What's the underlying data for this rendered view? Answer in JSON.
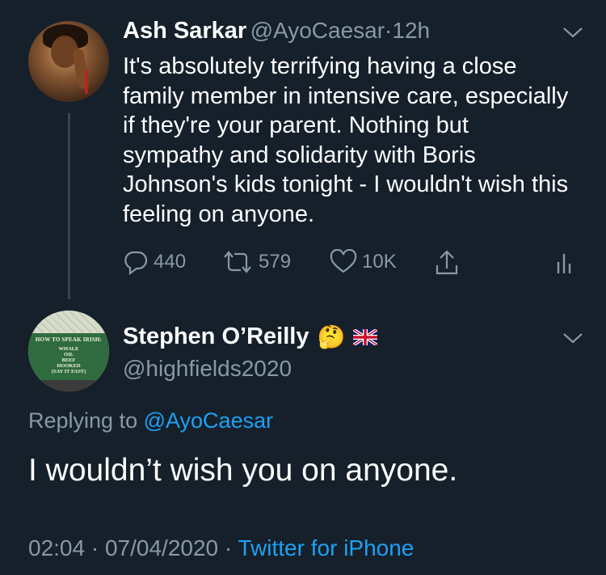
{
  "tweet": {
    "author_name": "Ash Sarkar",
    "author_handle": "@AyoCaesar",
    "separator": "·",
    "age": "12h",
    "text": "It's absolutely terrifying having a close family member in intensive care, especially if they're your parent. Nothing but sympathy and solidarity with Boris Johnson's kids tonight - I wouldn't wish this feeling on anyone.",
    "replies": "440",
    "retweets": "579",
    "likes": "10K"
  },
  "reply": {
    "author_name": "Stephen O’Reilly",
    "author_emoji": "🤔",
    "author_flag": "🇬🇧",
    "author_handle": "@highfields2020",
    "replying_prefix": "Replying to",
    "replying_to": "@AyoCaesar",
    "text": "I wouldn’t wish you on anyone.",
    "time": "02:04",
    "separator1": "·",
    "date": "07/04/2020",
    "separator2": "·",
    "source": "Twitter for iPhone"
  },
  "avatar_sign": {
    "line1": "HOW TO SPEAK IRISH:",
    "line2": "WHALE",
    "line3": "OIL",
    "line4": "BEEF",
    "line5": "HOOKED",
    "line6": "(SAY IT FAST)"
  },
  "icons": {
    "reply": "reply-icon",
    "retweet": "retweet-icon",
    "like": "heart-icon",
    "share": "share-icon",
    "analytics": "analytics-icon",
    "caret": "chevron-down-icon"
  },
  "colors": {
    "background": "#15202b",
    "secondary_text": "#8899a6",
    "link": "#1da1f2",
    "thread_line": "#38444d"
  }
}
